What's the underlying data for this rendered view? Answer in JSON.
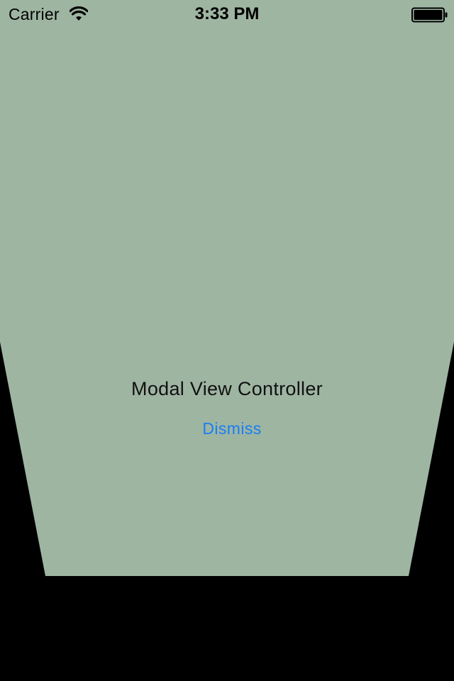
{
  "status_bar": {
    "carrier": "Carrier",
    "time": "3:33 PM",
    "wifi_icon": "wifi-icon",
    "battery_icon": "battery-full-icon"
  },
  "modal": {
    "title": "Modal View Controller",
    "dismiss_label": "Dismiss",
    "background_color": "#9eb5a2",
    "accent_color": "#1a7ef5"
  }
}
